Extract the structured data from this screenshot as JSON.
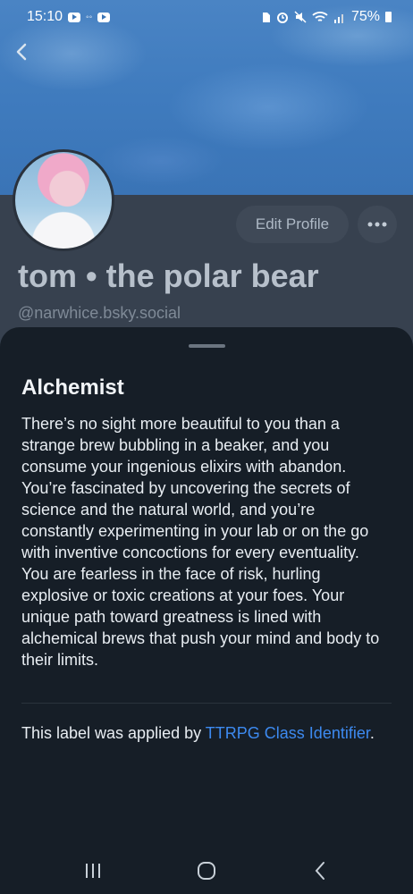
{
  "status_bar": {
    "time": "15:10",
    "battery": "75%",
    "left_icons": [
      "youtube-icon",
      "carrier-icon",
      "youtube-icon"
    ],
    "right_icons": [
      "sim-icon",
      "alarm-icon",
      "mute-icon",
      "wifi-icon",
      "signal-icon",
      "battery-icon"
    ]
  },
  "profile": {
    "display_name": "tom • the polar bear",
    "handle": "@narwhice.bsky.social",
    "edit_label": "Edit Profile",
    "more_icon": "more-horizontal-icon",
    "back_icon": "chevron-left-icon"
  },
  "sheet": {
    "title": "Alchemist",
    "description": "There’s no sight more beautiful to you than a strange brew bubbling in a beaker, and you consume your ingenious elixirs with abandon. You’re fascinated by uncovering the secrets of science and the natural world, and you’re constantly experimenting in your lab or on the go with inventive concoctions for every eventuality. You are fearless in the face of risk, hurling explosive or toxic creations at your foes. Your unique path toward greatness is lined with alchemical brews that push your mind and body to their limits.",
    "applied_prefix": "This label was applied by ",
    "applied_link": "TTRPG Class Identifier",
    "applied_suffix": "."
  },
  "nav": {
    "recents_icon": "recent-apps-icon",
    "home_icon": "home-icon",
    "back_icon": "back-icon"
  },
  "colors": {
    "banner": "#3f7bbe",
    "sheet_bg": "#161e27",
    "link": "#3d8af0"
  }
}
